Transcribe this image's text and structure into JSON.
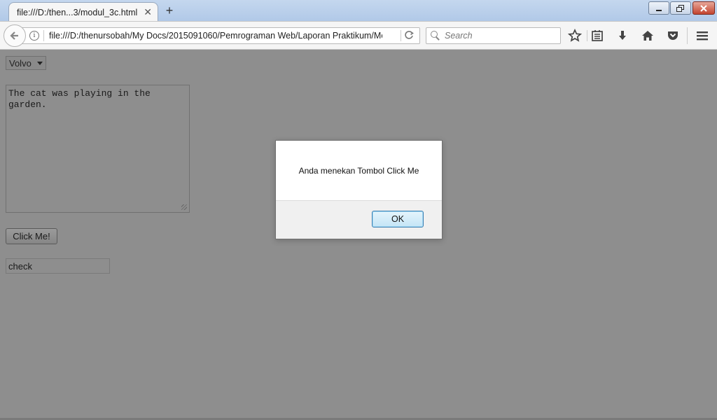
{
  "browser": {
    "tab_title": "file:///D:/then...3/modul_3c.html",
    "tab_close": "✕",
    "new_tab": "+",
    "url": "file:///D:/thenursobah/My Docs/2015091060/Pemrograman Web/Laporan Praktikum/Moc",
    "search_placeholder": "Search",
    "icons": {
      "back": "back-arrow-icon",
      "info": "info-icon",
      "reload": "reload-icon",
      "search": "search-icon",
      "bookmark": "star-icon",
      "reading_list": "reading-list-icon",
      "downloads": "download-icon",
      "home": "home-icon",
      "pocket": "pocket-icon",
      "menu": "hamburger-menu-icon"
    }
  },
  "page": {
    "select_value": "Volvo",
    "textarea_value": "The cat was playing in the\ngarden.",
    "button_label": "Click Me!",
    "input_value": "check"
  },
  "dialog": {
    "message": "Anda menekan Tombol Click Me",
    "ok_label": "OK"
  }
}
